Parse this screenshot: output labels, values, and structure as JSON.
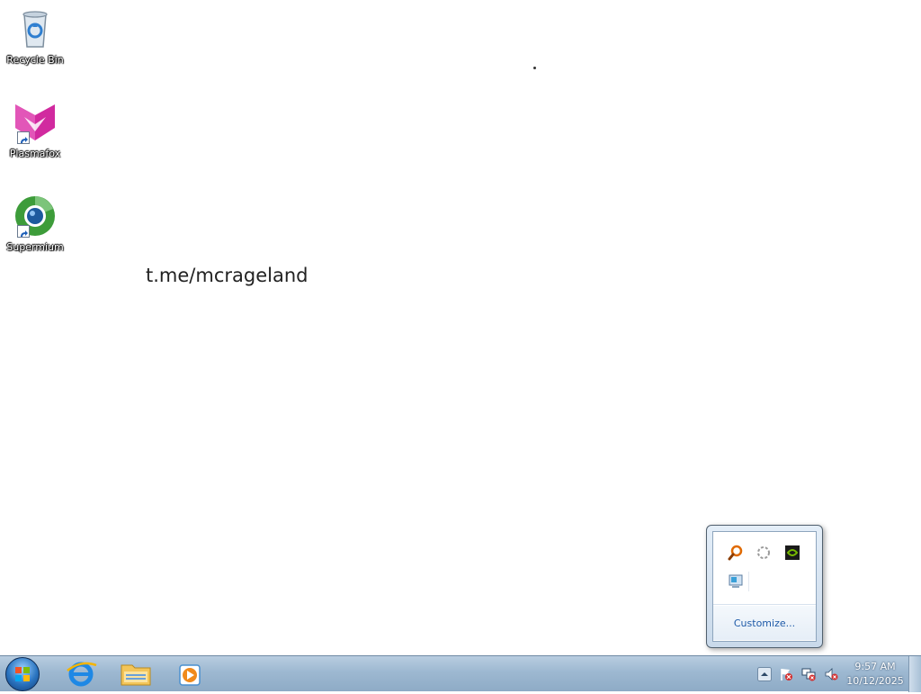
{
  "desktop": {
    "icons": [
      {
        "label": "Recycle Bin",
        "icon": "recycle-bin-icon"
      },
      {
        "label": "Plasmafox",
        "icon": "plasmafox-icon"
      },
      {
        "label": "Supermium",
        "icon": "supermium-icon"
      }
    ],
    "text": "t.me/mcrageland"
  },
  "tray_popup": {
    "icons": [
      "search-tool-icon",
      "loading-circle-icon",
      "nvidia-icon",
      "network-monitor-icon"
    ],
    "customize_label": "Customize..."
  },
  "taskbar": {
    "pinned": [
      "internet-explorer-icon",
      "file-explorer-icon",
      "media-player-icon"
    ],
    "tray_icons": [
      "show-hidden-icons-chevron",
      "action-center-flag-icon",
      "network-disconnected-icon",
      "volume-muted-icon"
    ],
    "clock": {
      "time": "9:57 AM",
      "date": "10/12/2025"
    }
  },
  "colors": {
    "taskbar": "#9db8d1",
    "link": "#1e5aa8",
    "plasmafox": "#d12a9f"
  }
}
